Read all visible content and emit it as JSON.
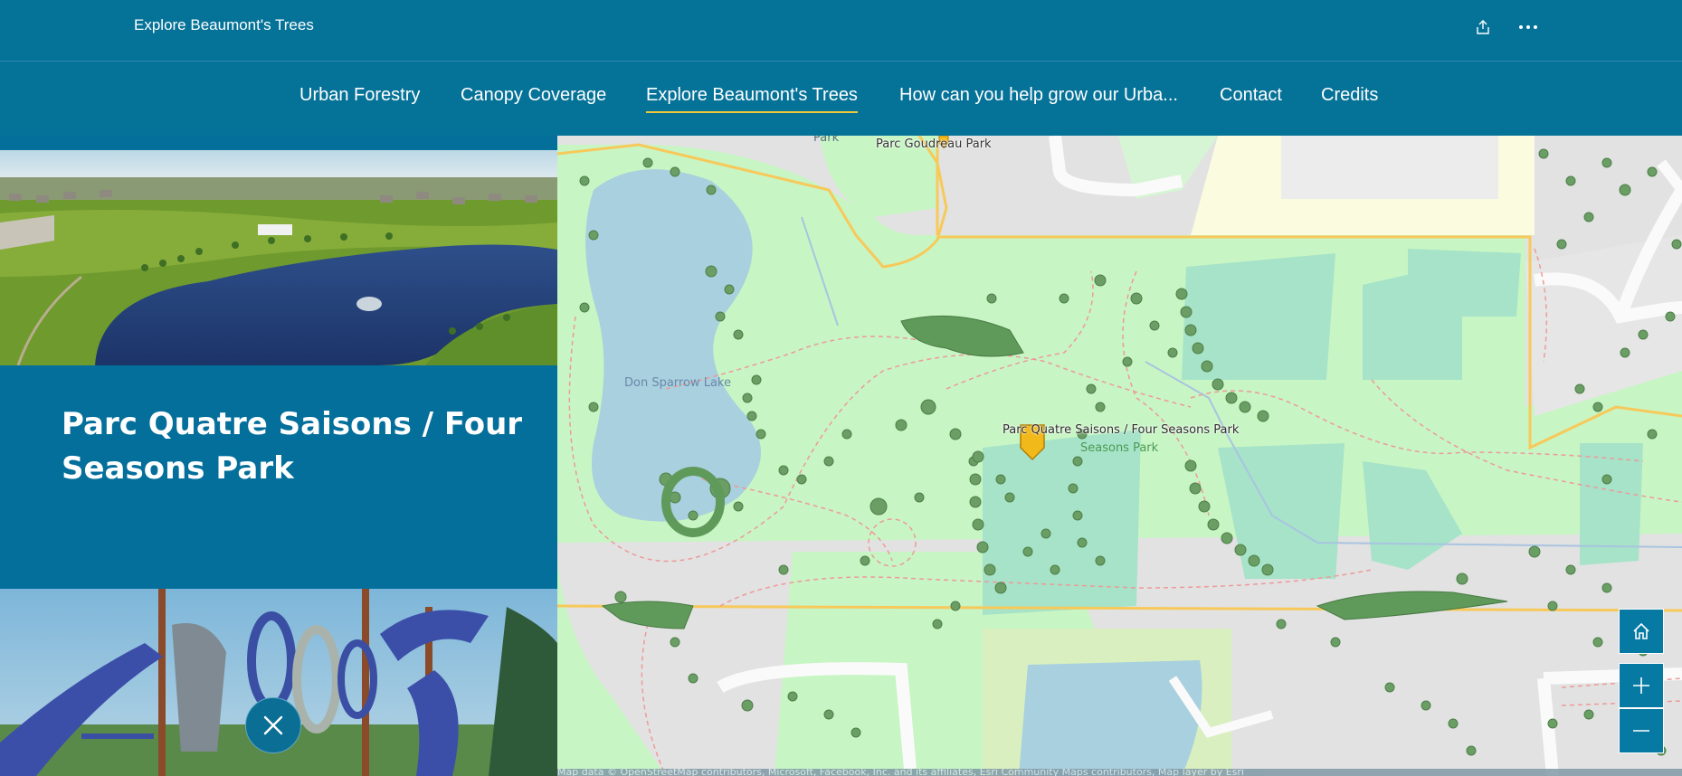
{
  "header": {
    "title": "Explore Beaumont's Trees",
    "share_icon": "share-icon",
    "more_icon": "more-options-icon"
  },
  "nav": {
    "items": [
      {
        "label": "Urban Forestry",
        "active": false
      },
      {
        "label": "Canopy Coverage",
        "active": false
      },
      {
        "label": "Explore Beaumont's Trees",
        "active": true
      },
      {
        "label": "How can you help grow our Urba...",
        "active": false
      },
      {
        "label": "Contact",
        "active": false
      },
      {
        "label": "Credits",
        "active": false
      }
    ],
    "active_color": "#f0c93a"
  },
  "sidebar": {
    "place_title": "Parc Quatre Saisons / Four Seasons Park",
    "close_icon": "close-icon",
    "background": "#046f9b"
  },
  "map": {
    "labels": {
      "park_top": "Park",
      "goudreau": "Parc Goudreau Park",
      "lake": "Don Sparrow Lake",
      "selected_park": "Parc Quatre Saisons / Four Seasons Park",
      "park_sub_1": "Parc",
      "park_sub_2": "Seasons Park"
    },
    "controls": {
      "home_icon": "home-icon",
      "zoom_in_icon": "plus-icon",
      "zoom_out_icon": "minus-icon"
    },
    "attribution": "Map data © OpenStreetMap contributors, Microsoft, Facebook, Inc. and its affiliates, Esri Community Maps contributors, Map layer by Esri"
  },
  "colors": {
    "brand": "#057298",
    "park_green": "#c8f5c4",
    "water": "#a9d0de",
    "tree": "#5f9e5b",
    "road": "#f7c95a",
    "marker": "#f2b91b"
  }
}
